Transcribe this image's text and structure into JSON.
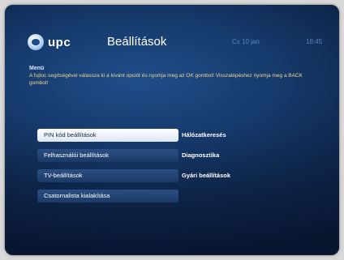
{
  "header": {
    "logo_text": "upc",
    "title": "Beállítások",
    "date": "Cs 10 jan",
    "time": "18:45"
  },
  "help": {
    "title": "Menü",
    "text": "A fujtoc segítségével válassza ki a kívánt opciót és nyomja meg az OK gombot! Visszalépéshez nyomja meg a BACK gombot!"
  },
  "menu": {
    "left": [
      {
        "label": "PIN kód beállítások",
        "selected": true
      },
      {
        "label": "Felhasználói beállítások",
        "selected": false
      },
      {
        "label": "TV-beállítások",
        "selected": false
      },
      {
        "label": "Csatornalista kialakítása",
        "selected": false
      }
    ],
    "right": [
      {
        "label": "Hálózatkeresés"
      },
      {
        "label": "Diagnosztika"
      },
      {
        "label": "Gyári beállítások"
      }
    ]
  },
  "colors": {
    "background": "#163a6c",
    "selected_item": "#ffffff",
    "help_text": "#f1d48b",
    "header_meta": "#5c86bf"
  }
}
